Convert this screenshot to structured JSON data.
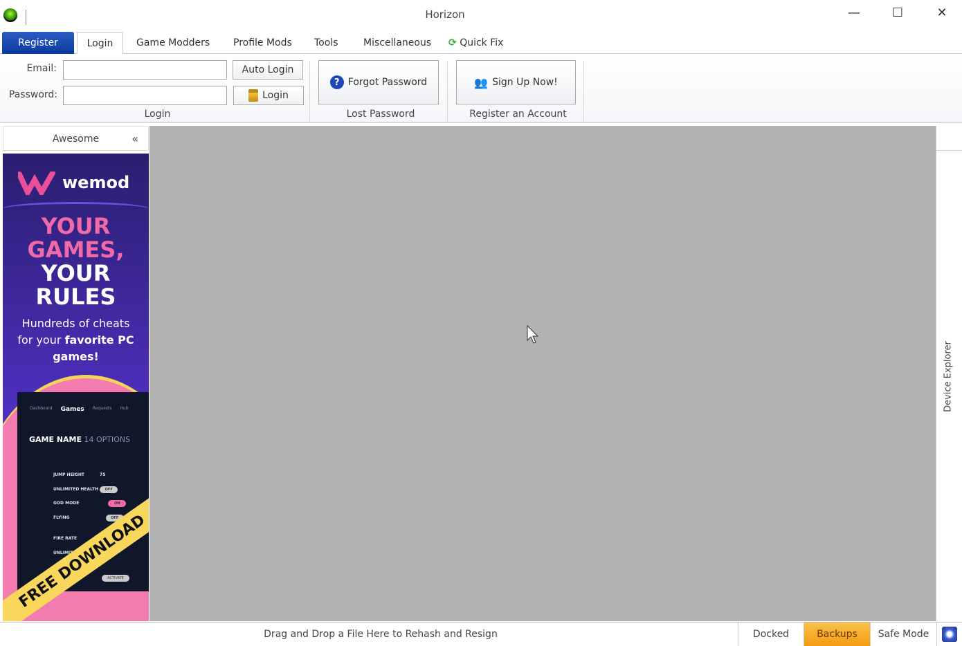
{
  "window": {
    "title": "Horizon",
    "minimize": "—",
    "maximize": "☐",
    "close": "✕"
  },
  "tabs": [
    "Register",
    "Login",
    "Game Modders",
    "Profile Mods",
    "Tools",
    "Miscellaneous",
    "Quick Fix"
  ],
  "ribbon": {
    "email_label": "Email:",
    "email_value": "",
    "password_label": "Password:",
    "password_value": "",
    "auto_login": "Auto Login",
    "login_button": "Login",
    "login_group": "Login",
    "forgot_password": "Forgot Password",
    "lost_password_group": "Lost Password",
    "sign_up": "Sign Up Now!",
    "register_group": "Register an Account"
  },
  "side_panel": {
    "title": "Awesome",
    "collapse": "«"
  },
  "ad": {
    "brand": "wemod",
    "headline": [
      "YOUR",
      "GAMES,",
      "YOUR",
      "RULES"
    ],
    "sub1": "Hundreds of cheats",
    "sub2a": "for your ",
    "sub2b": "favorite PC",
    "sub3": "games!",
    "nav": [
      "Dashboard",
      "Games",
      "Requests",
      "Hub"
    ],
    "game_name": "GAME NAME",
    "options": "14 OPTIONS",
    "cheats": [
      "JUMP HEIGHT",
      "UNLIMITED HEALTH",
      "GOD MODE",
      "FLYING",
      "FIRE RATE",
      "UNLIMITED"
    ],
    "value": "75",
    "off": "OFF",
    "on": "ON",
    "activate": "ACTIVATE",
    "banner": "FREE DOWNLOAD"
  },
  "right_panel": {
    "label": "Device Explorer"
  },
  "status": {
    "message": "Drag and Drop a File Here to Rehash and Resign",
    "docked": "Docked",
    "backups": "Backups",
    "safe_mode": "Safe Mode"
  },
  "colors": {
    "register_tab": "#0b3a9e",
    "backups": "#f7a824",
    "main_bg": "#b2b2b2"
  }
}
